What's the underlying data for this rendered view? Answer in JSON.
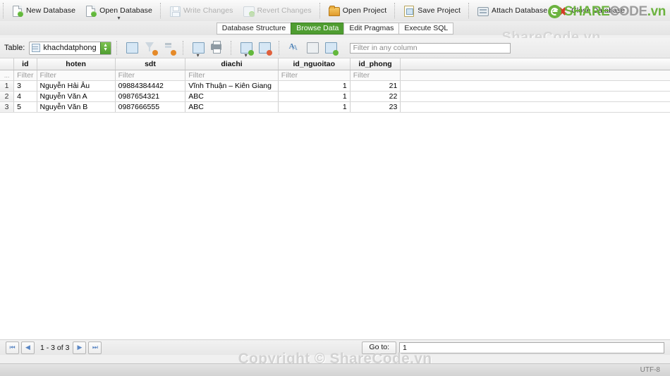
{
  "toolbar": {
    "buttons": [
      {
        "label": "New Database",
        "icon": "new-database-icon",
        "disabled": false,
        "chevron": false
      },
      {
        "label": "Open Database",
        "icon": "open-database-icon",
        "disabled": false,
        "chevron": true
      },
      {
        "label": "Write Changes",
        "icon": "write-changes-icon",
        "disabled": true,
        "chevron": false
      },
      {
        "label": "Revert Changes",
        "icon": "revert-changes-icon",
        "disabled": true,
        "chevron": false
      },
      {
        "label": "Open Project",
        "icon": "open-project-icon",
        "disabled": false,
        "chevron": false
      },
      {
        "label": "Save Project",
        "icon": "save-project-icon",
        "disabled": false,
        "chevron": false
      },
      {
        "label": "Attach Database",
        "icon": "attach-database-icon",
        "disabled": false,
        "chevron": false
      },
      {
        "label": "Close Database",
        "icon": "close-database-icon",
        "disabled": false,
        "chevron": false
      }
    ]
  },
  "brand": {
    "part1": "SHARE",
    "part2": "CODE",
    "part3": ".vn",
    "green": "#6cb33f",
    "grey": "#9d9d9d"
  },
  "tabs": [
    {
      "label": "Database Structure",
      "active": false
    },
    {
      "label": "Browse Data",
      "active": true
    },
    {
      "label": "Edit Pragmas",
      "active": false
    },
    {
      "label": "Execute SQL",
      "active": false
    }
  ],
  "watermarks": {
    "top": "ShareCode.vn",
    "bottom": "Copyright © ShareCode.vn"
  },
  "table_toolbar": {
    "table_label": "Table:",
    "table_name": "khachdatphong",
    "icons": [
      "refresh-icon",
      "clear-filters-icon",
      "clear-sorting-icon",
      "save-results-icon",
      "print-icon",
      "insert-record-icon",
      "delete-record-icon",
      "edit-cell-icon",
      "import-blob-icon",
      "set-as-null-icon"
    ],
    "filter_placeholder": "Filter in any column",
    "filter_value": ""
  },
  "grid": {
    "columns": [
      "id",
      "hoten",
      "sdt",
      "diachi",
      "id_nguoitao",
      "id_phong"
    ],
    "filter_placeholder": "Filter",
    "rows": [
      {
        "n": "1",
        "id": "3",
        "hoten": "Nguyễn Hải Âu",
        "sdt": "09884384442",
        "diachi": "Vĩnh Thuận – Kiên Giang",
        "id_nguoitao": "1",
        "id_phong": "21"
      },
      {
        "n": "2",
        "id": "4",
        "hoten": "Nguyễn Văn A",
        "sdt": "0987654321",
        "diachi": "ABC",
        "id_nguoitao": "1",
        "id_phong": "22"
      },
      {
        "n": "3",
        "id": "5",
        "hoten": "Nguyễn Văn B",
        "sdt": "0987666555",
        "diachi": "ABC",
        "id_nguoitao": "1",
        "id_phong": "23"
      }
    ]
  },
  "navbar": {
    "first_label": "⏮",
    "prev_label": "◀",
    "next_label": "▶",
    "last_label": "⏭",
    "range": "1 - 3 of 3",
    "goto_label": "Go to:",
    "goto_value": "1"
  },
  "statusbar": {
    "encoding": "UTF-8"
  }
}
